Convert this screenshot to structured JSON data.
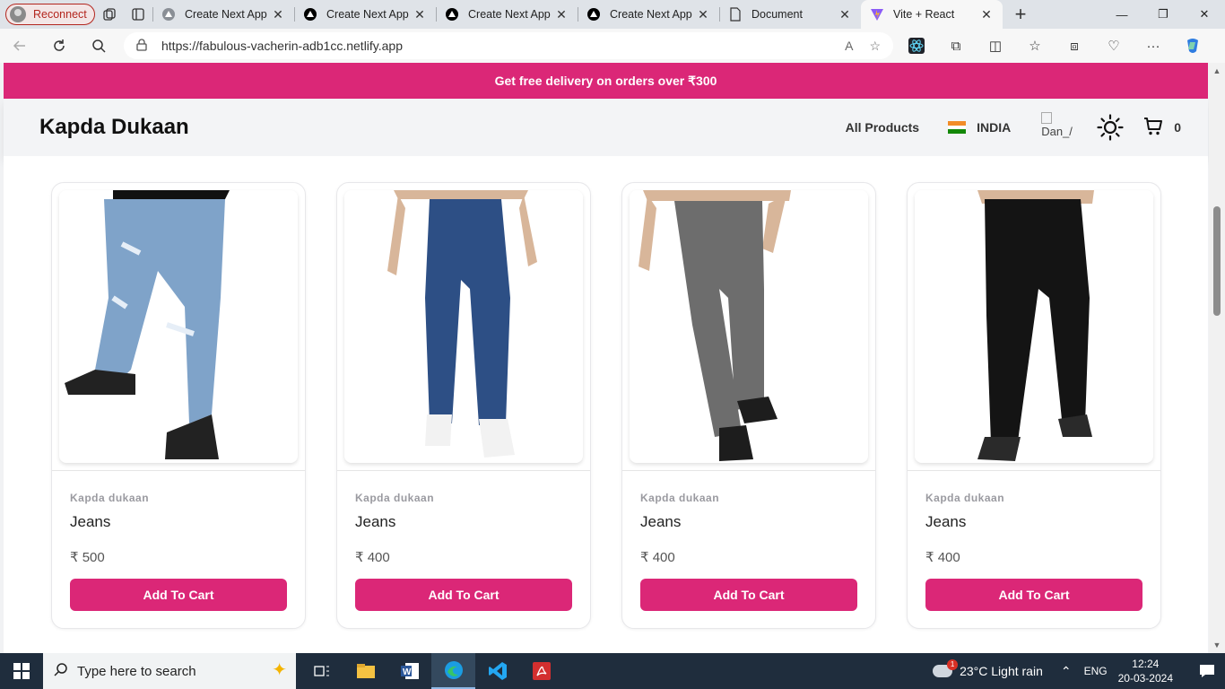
{
  "browser": {
    "reconnect_label": "Reconnect",
    "tabs": [
      {
        "label": "Create Next App",
        "icon": "triangle-icon"
      },
      {
        "label": "Create Next App",
        "icon": "nextjs-icon"
      },
      {
        "label": "Create Next App",
        "icon": "nextjs-icon"
      },
      {
        "label": "Create Next App",
        "icon": "nextjs-icon"
      },
      {
        "label": "Document",
        "icon": "document-icon"
      },
      {
        "label": "Vite + React",
        "icon": "vite-icon"
      }
    ],
    "url": "https://fabulous-vacherin-adb1cc.netlify.app"
  },
  "page": {
    "banner": "Get free delivery on orders over ₹300",
    "brand": "Kapda Dukaan",
    "nav": {
      "all_products": "All Products",
      "country": "INDIA",
      "avatar_alt": "Dan_/",
      "cart_count": "0"
    },
    "products": [
      {
        "vendor": "Kapda dukaan",
        "name": "Jeans",
        "price": "₹ 500",
        "button": "Add To Cart",
        "color": "#7fa3c9"
      },
      {
        "vendor": "Kapda dukaan",
        "name": "Jeans",
        "price": "₹ 400",
        "button": "Add To Cart",
        "color": "#2d4f85"
      },
      {
        "vendor": "Kapda dukaan",
        "name": "Jeans",
        "price": "₹ 400",
        "button": "Add To Cart",
        "color": "#6d6d6d"
      },
      {
        "vendor": "Kapda dukaan",
        "name": "Jeans",
        "price": "₹ 400",
        "button": "Add To Cart",
        "color": "#141414"
      }
    ],
    "accent_color": "#db2777"
  },
  "taskbar": {
    "search_placeholder": "Type here to search",
    "weather": "23°C  Light rain",
    "language": "ENG",
    "time": "12:24",
    "date": "20-03-2024"
  }
}
